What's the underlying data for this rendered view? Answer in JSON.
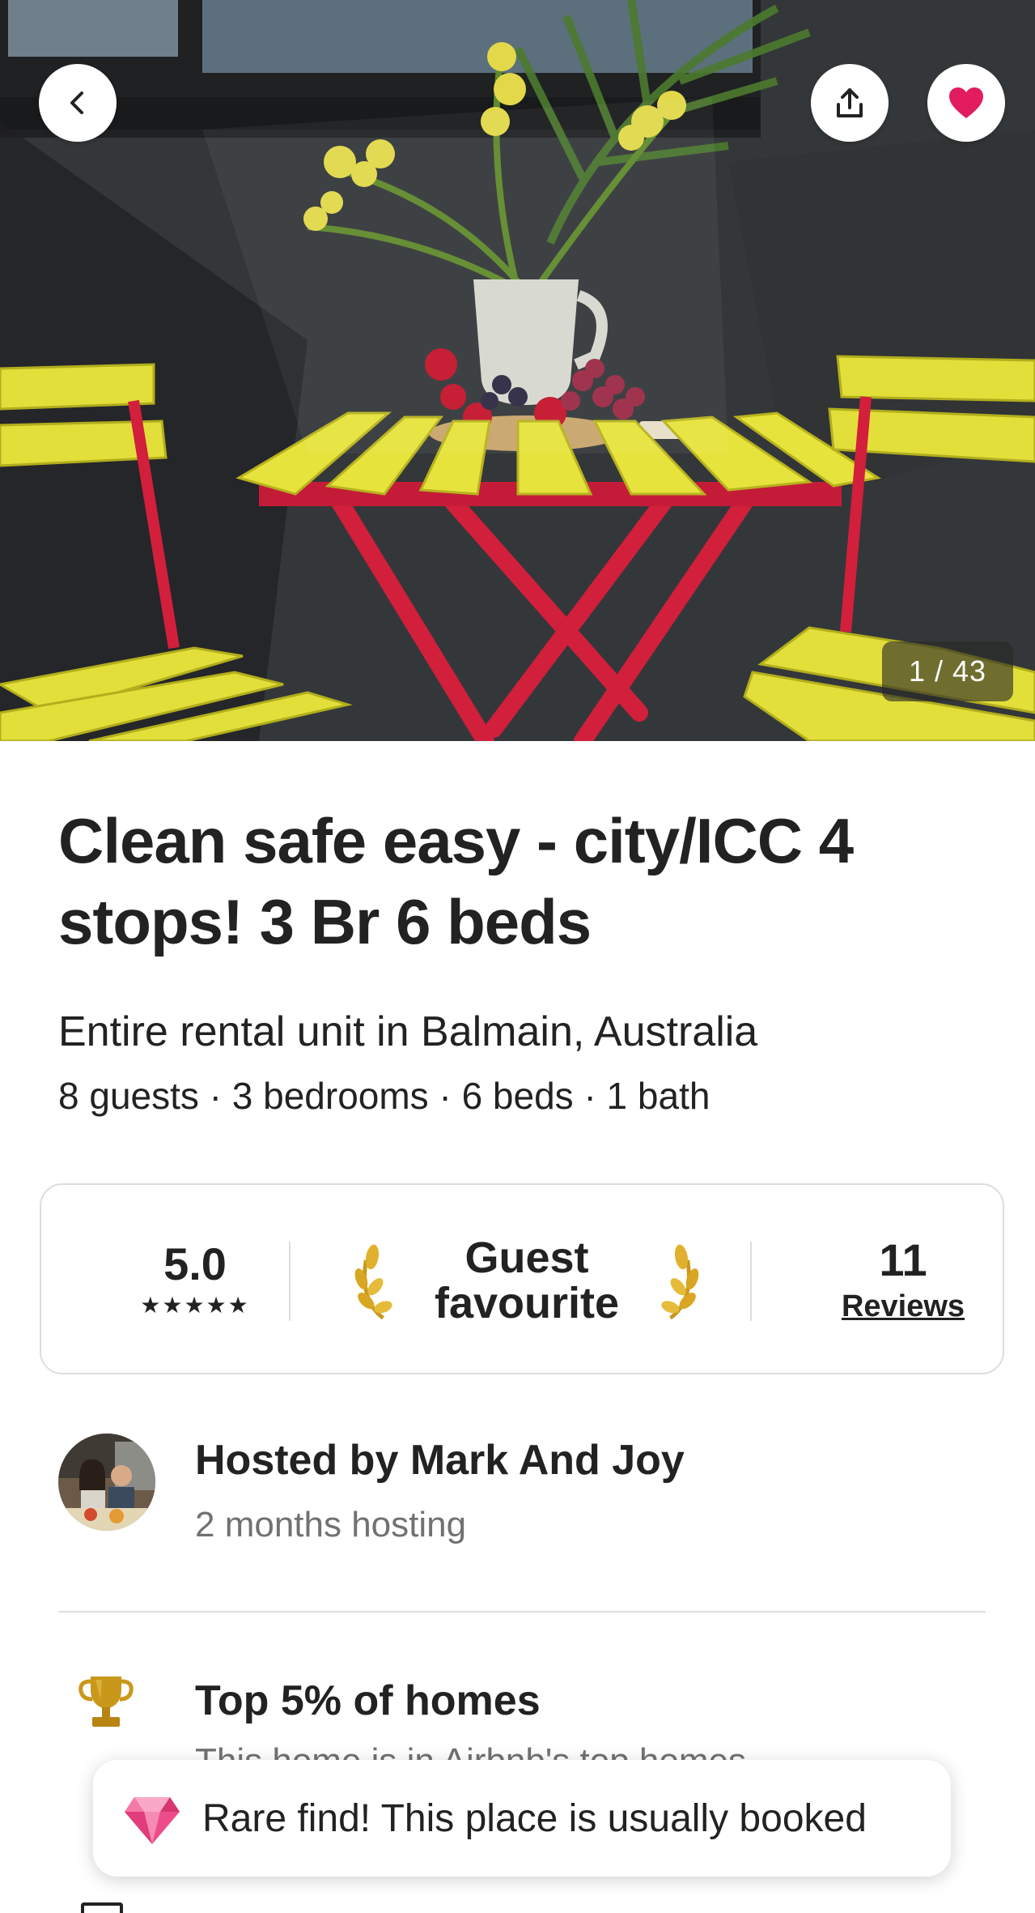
{
  "photo": {
    "counter": "1 / 43",
    "back_icon": "chevron-left-icon",
    "share_icon": "share-icon",
    "favourite_icon": "heart-icon",
    "favourite_color": "#e31c5f"
  },
  "listing": {
    "title": "Clean safe easy - city/ICC 4 stops! 3 Br 6 beds",
    "subtitle": "Entire rental unit in Balmain, Australia",
    "details": "8 guests · 3 bedrooms · 6 beds · 1 bath"
  },
  "stats": {
    "rating": "5.0",
    "stars": "★★★★★",
    "rating_count_stars": 5,
    "guest_favourite_label": "Guest favourite",
    "reviews_count": "11",
    "reviews_label": "Reviews"
  },
  "host": {
    "name": "Hosted by Mark And Joy",
    "since": "2 months hosting"
  },
  "highlight": {
    "icon": "trophy-icon",
    "title": "Top 5% of homes",
    "subtitle": "This home is in Airbnb's top homes..."
  },
  "toast": {
    "icon": "diamond-icon",
    "text": "Rare find! This place is usually booked"
  },
  "colors": {
    "text": "#222222",
    "muted": "#717171",
    "border": "#dddddd",
    "brand": "#e31c5f",
    "gold": "#d4a017"
  }
}
